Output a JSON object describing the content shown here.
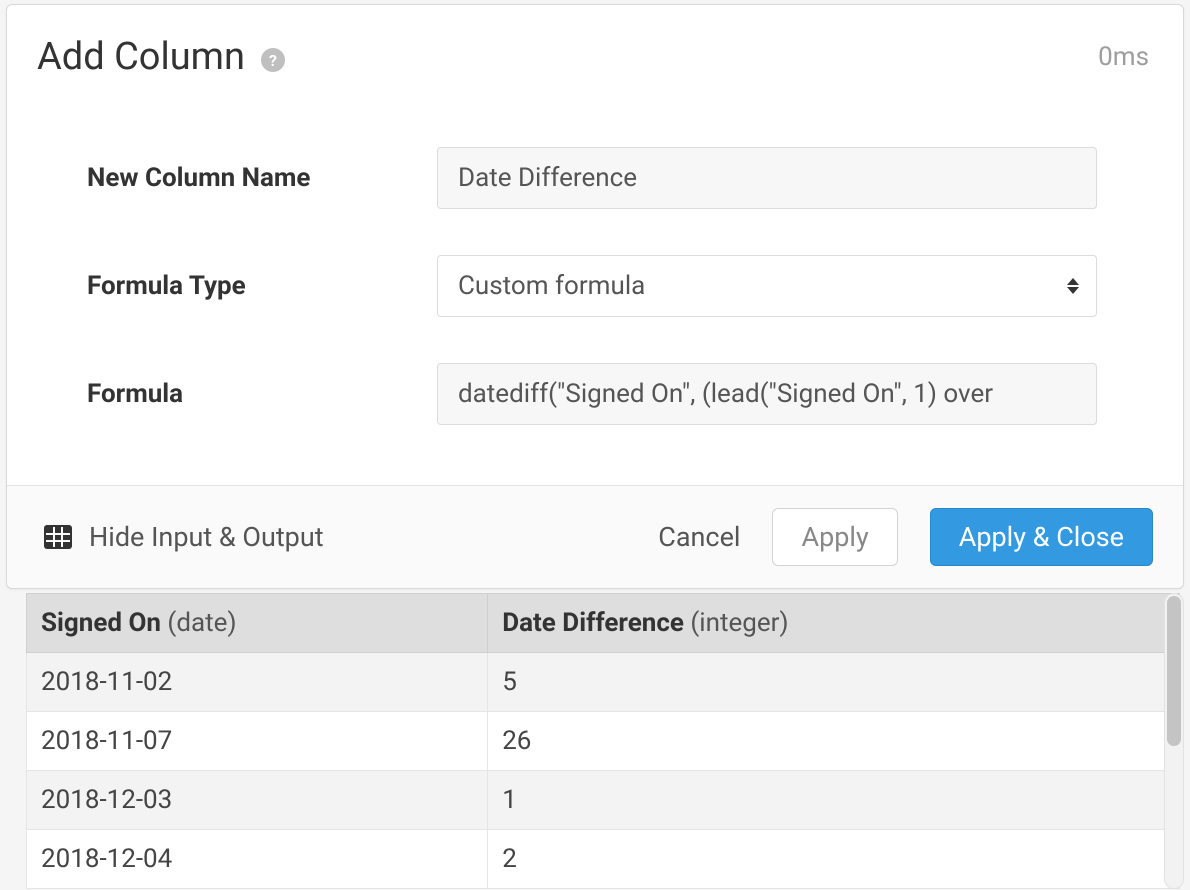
{
  "header": {
    "title": "Add Column",
    "help_icon": "?",
    "timing": "0ms"
  },
  "form": {
    "name_label": "New Column Name",
    "name_value": "Date Difference",
    "type_label": "Formula Type",
    "type_value": "Custom formula",
    "formula_label": "Formula",
    "formula_value": "datediff(\"Signed On\", (lead(\"Signed On\", 1) over "
  },
  "footer": {
    "toggle_label": "Hide Input & Output",
    "cancel_label": "Cancel",
    "apply_label": "Apply",
    "apply_close_label": "Apply & Close"
  },
  "table": {
    "columns": [
      {
        "name": "Signed On",
        "type": "date"
      },
      {
        "name": "Date Difference",
        "type": "integer"
      }
    ],
    "rows": [
      {
        "signed_on": "2018-11-02",
        "diff": "5"
      },
      {
        "signed_on": "2018-11-07",
        "diff": "26"
      },
      {
        "signed_on": "2018-12-03",
        "diff": "1"
      },
      {
        "signed_on": "2018-12-04",
        "diff": "2"
      }
    ]
  }
}
